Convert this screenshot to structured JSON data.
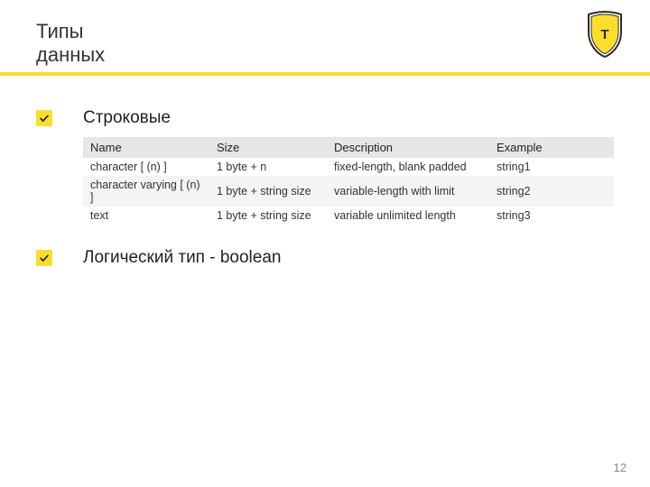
{
  "header": {
    "title_line1": "Типы",
    "title_line2": "данных"
  },
  "logo": {
    "name": "shield-logo"
  },
  "sections": [
    {
      "label": "Строковые"
    },
    {
      "label": "Логический тип - boolean"
    }
  ],
  "table": {
    "headers": {
      "name": "Name",
      "size": "Size",
      "description": "Description",
      "example": "Example"
    },
    "rows": [
      {
        "name": "character [ (n) ]",
        "size": "1 byte + n",
        "description": "fixed-length, blank padded",
        "example": "string1"
      },
      {
        "name": "character varying [ (n) ]",
        "size": "1 byte + string size",
        "description": "variable-length with limit",
        "example": "string2"
      },
      {
        "name": "text",
        "size": "1 byte + string size",
        "description": "variable unlimited length",
        "example": "string3"
      }
    ]
  },
  "page_number": "12"
}
